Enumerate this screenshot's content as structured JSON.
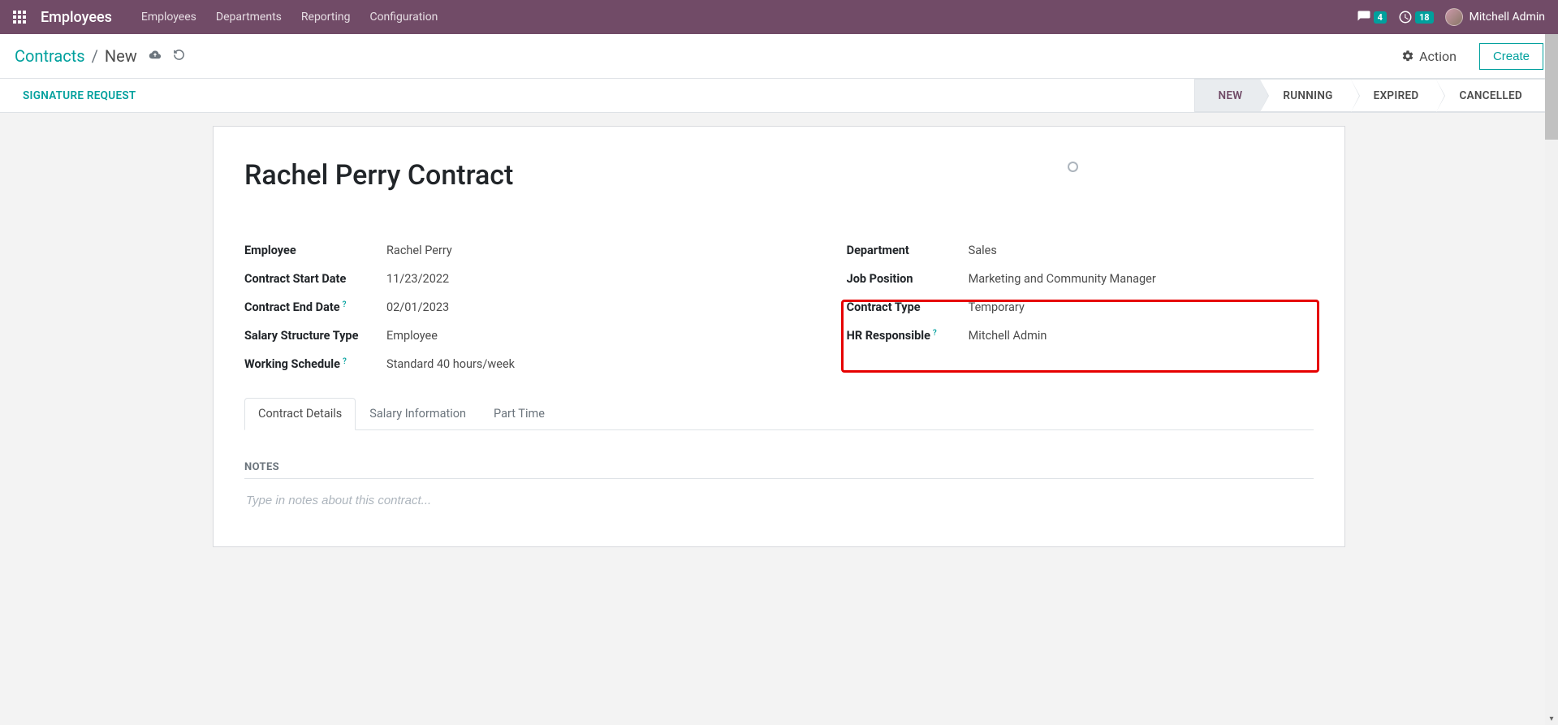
{
  "navbar": {
    "brand": "Employees",
    "links": [
      "Employees",
      "Departments",
      "Reporting",
      "Configuration"
    ],
    "messages_count": "4",
    "activities_count": "18",
    "user_name": "Mitchell Admin"
  },
  "action_bar": {
    "breadcrumb_root": "Contracts",
    "breadcrumb_sep": "/",
    "breadcrumb_leaf": "New",
    "action_label": "Action",
    "create_label": "Create"
  },
  "sub_bar": {
    "signature_request": "SIGNATURE REQUEST",
    "statuses": [
      "NEW",
      "RUNNING",
      "EXPIRED",
      "CANCELLED"
    ],
    "active_index": 0
  },
  "record": {
    "title": "Rachel Perry Contract"
  },
  "fields_left": {
    "employee": {
      "label": "Employee",
      "value": "Rachel Perry"
    },
    "start_date": {
      "label": "Contract Start Date",
      "value": "11/23/2022"
    },
    "end_date": {
      "label": "Contract End Date",
      "value": "02/01/2023",
      "help": true
    },
    "salary_type": {
      "label": "Salary Structure Type",
      "value": "Employee"
    },
    "schedule": {
      "label": "Working Schedule",
      "value": "Standard 40 hours/week",
      "help": true
    }
  },
  "fields_right": {
    "department": {
      "label": "Department",
      "value": "Sales"
    },
    "job": {
      "label": "Job Position",
      "value": "Marketing and Community Manager"
    },
    "contract_type": {
      "label": "Contract Type",
      "value": "Temporary"
    },
    "hr": {
      "label": "HR Responsible",
      "value": "Mitchell Admin",
      "help": true
    }
  },
  "tabs": [
    "Contract Details",
    "Salary Information",
    "Part Time"
  ],
  "notes": {
    "heading": "NOTES",
    "placeholder": "Type in notes about this contract..."
  }
}
